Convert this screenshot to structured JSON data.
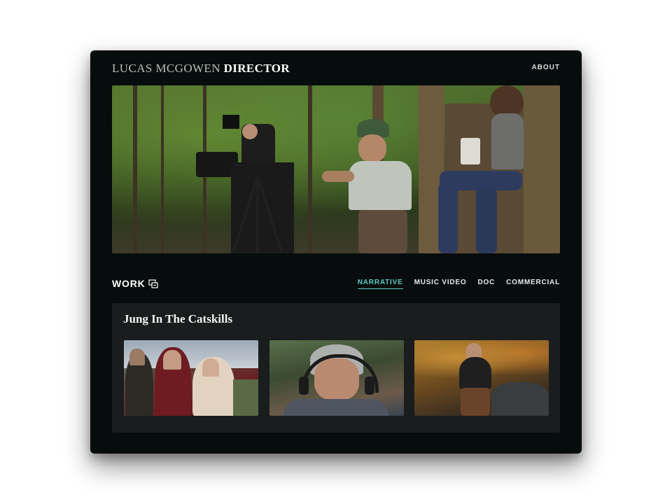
{
  "site": {
    "name": "LUCAS MCGOWEN",
    "role": "DIRECTOR",
    "nav": {
      "about": "ABOUT"
    }
  },
  "hero": {
    "icon": "film-set-photo"
  },
  "work": {
    "title": "WORK",
    "icon": "film-clapper-icon",
    "filters": [
      {
        "label": "NARRATIVE",
        "active": true
      },
      {
        "label": "MUSIC VIDEO",
        "active": false
      },
      {
        "label": "DOC",
        "active": false
      },
      {
        "label": "COMMERCIAL",
        "active": false
      }
    ]
  },
  "project": {
    "title": "Jung In The Catskills",
    "thumbnails": [
      {
        "icon": "still-frame-trio"
      },
      {
        "icon": "still-frame-headphones"
      },
      {
        "icon": "still-frame-forest"
      }
    ]
  },
  "colors": {
    "background": "#060d0c",
    "accent": "#5fc9c3",
    "card": "#191d1e"
  }
}
